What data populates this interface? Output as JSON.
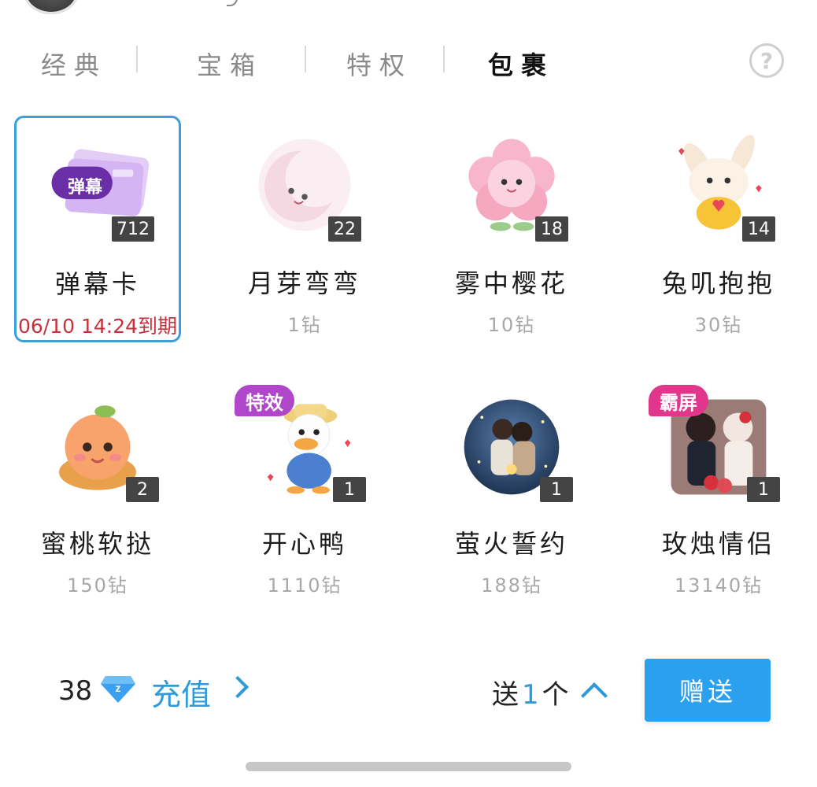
{
  "tabs": [
    {
      "label": "经典",
      "active": false
    },
    {
      "label": "宝箱",
      "active": false
    },
    {
      "label": "特权",
      "active": false
    },
    {
      "label": "包裹",
      "active": true
    }
  ],
  "help_label": "?",
  "gifts": [
    {
      "name": "弹幕卡",
      "count": "712",
      "expire": "06/10 14:24到期",
      "price": "",
      "selected": true,
      "badge": "",
      "thumb_text": "弹幕"
    },
    {
      "name": "月芽弯弯",
      "count": "22",
      "price": "1钻",
      "selected": false,
      "badge": ""
    },
    {
      "name": "雾中樱花",
      "count": "18",
      "price": "10钻",
      "selected": false,
      "badge": ""
    },
    {
      "name": "兔叽抱抱",
      "count": "14",
      "price": "30钻",
      "selected": false,
      "badge": ""
    },
    {
      "name": "蜜桃软挞",
      "count": "2",
      "price": "150钻",
      "selected": false,
      "badge": ""
    },
    {
      "name": "开心鸭",
      "count": "1",
      "price": "1110钻",
      "selected": false,
      "badge": "特效"
    },
    {
      "name": "萤火誓约",
      "count": "1",
      "price": "188钻",
      "selected": false,
      "badge": ""
    },
    {
      "name": "玫烛情侣",
      "count": "1",
      "price": "13140钻",
      "selected": false,
      "badge": "霸屏"
    }
  ],
  "footer": {
    "balance": "38",
    "recharge_label": "充值",
    "send_prefix": "送",
    "send_qty": "1",
    "send_unit": "个",
    "give_label": "赠送"
  },
  "colors": {
    "accent": "#2f9ad8",
    "button": "#2aa0ef",
    "expire": "#c8313b",
    "badge_effect": "#b046c9",
    "badge_screen": "#e0368c"
  }
}
